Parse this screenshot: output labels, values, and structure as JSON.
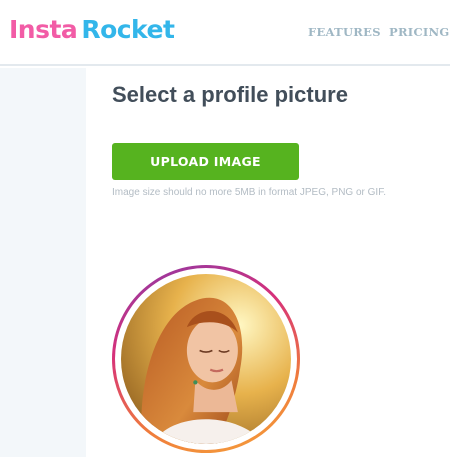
{
  "brand": {
    "part1": "Insta",
    "part2": "Rocket"
  },
  "nav": {
    "features": "FEATURES",
    "pricing": "PRICING"
  },
  "main": {
    "title": "Select a profile picture",
    "upload_label": "UPLOAD IMAGE",
    "hint": "Image size should no more 5MB in format JPEG, PNG or GIF."
  },
  "colors": {
    "brand_pink": "#f25ca6",
    "brand_blue": "#33b6ea",
    "upload_green": "#56b31f",
    "nav_text": "#9fb7c4"
  }
}
